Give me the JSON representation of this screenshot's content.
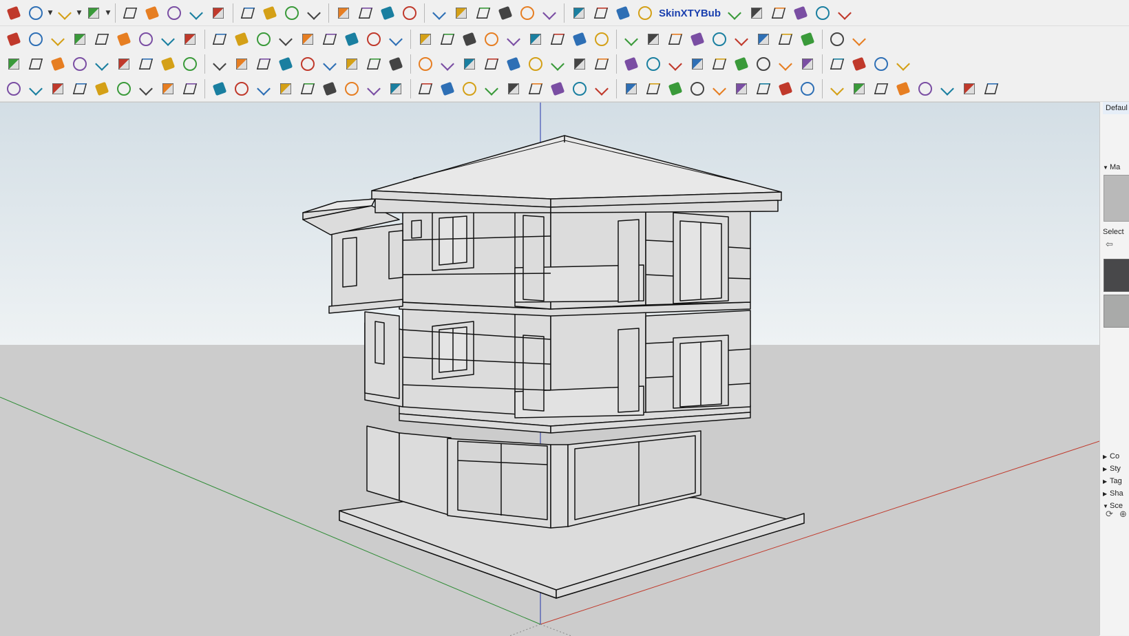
{
  "toolbars": {
    "row1": {
      "icons": [
        "eraser-icon",
        "pencil-icon",
        "arc-icon",
        "rectangle-icon",
        "push-pull-icon",
        "follow-me-icon",
        "move-icon",
        "rotate-icon",
        "scale-icon",
        "tape-measure-icon",
        "text-icon",
        "paint-bucket-icon",
        "orbit-icon",
        "pan-icon",
        "zoom-icon",
        "zoom-extents-icon",
        "component-icon",
        "section-plane-icon",
        "layers-icon",
        "warehouse-icon",
        "user-icon",
        "map-icon",
        "tag-icon",
        "sandbox-icon",
        "box-stack-icon",
        "red-box-icon",
        "globe-icon",
        "cloud-1-icon",
        "cloud-2-icon",
        "cloud-3-icon",
        "play-icon",
        "stop-icon",
        "help-icon"
      ],
      "extension_label": "SkinXTYBub"
    },
    "row2": {
      "tool_count": 38
    },
    "row3": {
      "tool_count": 40
    },
    "row4": {
      "tool_count": 44
    }
  },
  "colors": {
    "sky_top": "#d3dee5",
    "sky_bottom": "#eef2f4",
    "ground": "#cccccc",
    "axis_red": "#c0392b",
    "axis_green": "#2e8b35",
    "axis_blue": "#2233aa",
    "building_face": "#dcdcdc",
    "edge": "#111111"
  },
  "tray": {
    "title": "Defaul",
    "materials_header": "Ma",
    "select_label": "Select",
    "sections": [
      {
        "label": "Co",
        "open": false
      },
      {
        "label": "Sty",
        "open": false
      },
      {
        "label": "Tag",
        "open": false
      },
      {
        "label": "Sha",
        "open": false
      },
      {
        "label": "Sce",
        "open": true
      }
    ]
  }
}
